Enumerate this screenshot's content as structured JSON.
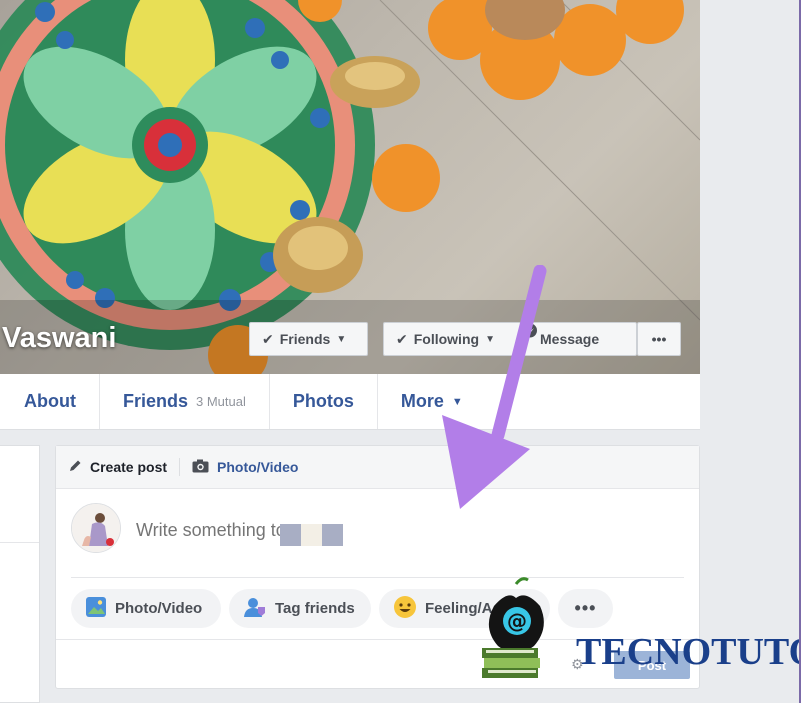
{
  "profile": {
    "name": "Vaswani"
  },
  "cover_actions": {
    "friends_label": "Friends",
    "following_label": "Following",
    "message_label": "Message",
    "more_label": "•••"
  },
  "tabs": [
    {
      "label": "About"
    },
    {
      "label": "Friends",
      "sub": "3 Mutual"
    },
    {
      "label": "Photos"
    },
    {
      "label": "More"
    }
  ],
  "composer": {
    "create_post_label": "Create post",
    "photo_video_label": "Photo/Video",
    "placeholder": "Write something to",
    "actions": {
      "photo_video": "Photo/Video",
      "tag_friends": "Tag friends",
      "feeling": "Feeling/A",
      "more": "•••"
    },
    "post_label": "Post"
  },
  "watermark": {
    "text": "TECNOTUTO"
  },
  "colors": {
    "link_blue": "#365899",
    "page_bg": "#e9ebee",
    "arrow_purple": "#b27ee8",
    "post_button": "#9cb4d8"
  }
}
